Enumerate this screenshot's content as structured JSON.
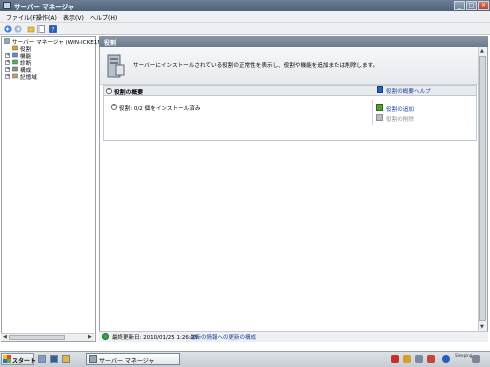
{
  "window": {
    "title": "サーバー マネージャ",
    "controls": {
      "minimize": "_",
      "maximize": "□",
      "close": "×"
    }
  },
  "menu": [
    "ファイル(F)",
    "操作(A)",
    "表示(V)",
    "ヘルプ(H)"
  ],
  "toolbar": {
    "icons": [
      "back-icon",
      "forward-icon",
      "up-icon",
      "show-hide-tree-icon",
      "help-icon"
    ]
  },
  "tree": {
    "root": "サーバー マネージャ (WIN-ICKE1M",
    "items": [
      "役割",
      "機能",
      "診断",
      "構成",
      "記憶域"
    ]
  },
  "right": {
    "header": "役割",
    "banner_text": "サーバーにインストールされている役割の正常性を表示し、役割や機能を追加または削除します。",
    "summary": {
      "title": "役割の概要",
      "help_link": "役割の概要ヘルプ",
      "roles_text": "役割: 0/2 個をインストール済み",
      "add_roles": "役割の追加",
      "remove_roles": "役割の削除"
    },
    "status": {
      "last_refresh": "最終更新日: 2010/01/25 1:26:25",
      "configure_link": "最新の情報への更新の構成"
    }
  },
  "taskbar": {
    "start": "スタート",
    "task": "サーバー マネージャ",
    "clock": "Sleeping"
  },
  "colors": {
    "link": "#1a3f9e",
    "title_bar": "#4f627b",
    "pane_header": "#6c7a8c"
  }
}
